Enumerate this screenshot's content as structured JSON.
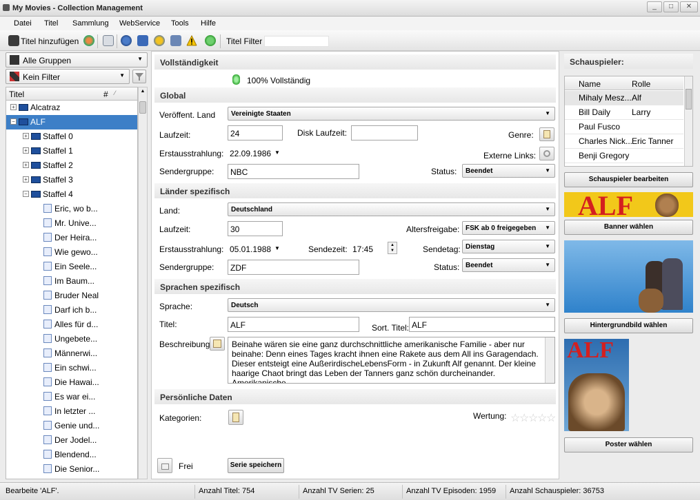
{
  "window": {
    "title": "My Movies - Collection Management"
  },
  "menu": [
    "Datei",
    "Titel",
    "Sammlung",
    "WebService",
    "Tools",
    "Hilfe"
  ],
  "toolbar": {
    "add_title": "Titel hinzufügen",
    "filter_label": "Titel Filter",
    "filter_value": ""
  },
  "left": {
    "group_combo": "Alle Gruppen",
    "filter_combo": "Kein Filter",
    "header_title": "Titel",
    "header_num": "#",
    "tree": [
      {
        "label": "Alcatraz",
        "level": 0,
        "expander": "+",
        "icon": "tv"
      },
      {
        "label": "ALF",
        "level": 0,
        "expander": "−",
        "icon": "tv",
        "selected": true
      },
      {
        "label": "Staffel 0",
        "level": 1,
        "expander": "+",
        "icon": "tv"
      },
      {
        "label": "Staffel 1",
        "level": 1,
        "expander": "+",
        "icon": "tv"
      },
      {
        "label": "Staffel 2",
        "level": 1,
        "expander": "+",
        "icon": "tv"
      },
      {
        "label": "Staffel 3",
        "level": 1,
        "expander": "+",
        "icon": "tv"
      },
      {
        "label": "Staffel 4",
        "level": 1,
        "expander": "−",
        "icon": "tv"
      },
      {
        "label": "Eric, wo b...",
        "level": 2,
        "icon": "ep"
      },
      {
        "label": "Mr. Unive...",
        "level": 2,
        "icon": "ep"
      },
      {
        "label": "Der Heira...",
        "level": 2,
        "icon": "ep"
      },
      {
        "label": "Wie gewo...",
        "level": 2,
        "icon": "ep"
      },
      {
        "label": "Ein Seele...",
        "level": 2,
        "icon": "ep"
      },
      {
        "label": "Im Baum...",
        "level": 2,
        "icon": "ep"
      },
      {
        "label": "Bruder Neal",
        "level": 2,
        "icon": "ep"
      },
      {
        "label": "Darf ich b...",
        "level": 2,
        "icon": "ep"
      },
      {
        "label": "Alles für d...",
        "level": 2,
        "icon": "ep"
      },
      {
        "label": "Ungebete...",
        "level": 2,
        "icon": "ep"
      },
      {
        "label": "Männerwi...",
        "level": 2,
        "icon": "ep"
      },
      {
        "label": "Ein schwi...",
        "level": 2,
        "icon": "ep"
      },
      {
        "label": "Die Hawai...",
        "level": 2,
        "icon": "ep"
      },
      {
        "label": "Es war ei...",
        "level": 2,
        "icon": "ep"
      },
      {
        "label": "In letzter ...",
        "level": 2,
        "icon": "ep"
      },
      {
        "label": "Genie und...",
        "level": 2,
        "icon": "ep"
      },
      {
        "label": "Der Jodel...",
        "level": 2,
        "icon": "ep"
      },
      {
        "label": "Blendend...",
        "level": 2,
        "icon": "ep"
      },
      {
        "label": "Die Senior...",
        "level": 2,
        "icon": "ep"
      }
    ]
  },
  "main": {
    "completeness": {
      "header": "Vollständigkeit",
      "value": "100% Vollständig"
    },
    "global": {
      "header": "Global",
      "release_country_label": "Veröffent. Land",
      "release_country": "Vereinigte Staaten",
      "runtime_label": "Laufzeit:",
      "runtime": "24",
      "disc_runtime_label": "Disk Laufzeit:",
      "disc_runtime": "",
      "genre_label": "Genre:",
      "first_air_label": "Erstausstrahlung:",
      "first_air": "22.09.1986",
      "external_links_label": "Externe Links:",
      "network_label": "Sendergruppe:",
      "network": "NBC",
      "status_label": "Status:",
      "status": "Beendet"
    },
    "country": {
      "header": "Länder spezifisch",
      "country_label": "Land:",
      "country": "Deutschland",
      "runtime_label": "Laufzeit:",
      "runtime": "30",
      "rating_label": "Altersfreigabe:",
      "rating": "FSK ab 0 freigegeben",
      "first_air_label": "Erstausstrahlung:",
      "first_air": "05.01.1988",
      "airtime_label": "Sendezeit:",
      "airtime": "17:45",
      "airday_label": "Sendetag:",
      "airday": "Dienstag",
      "network_label": "Sendergruppe:",
      "network": "ZDF",
      "status_label": "Status:",
      "status": "Beendet"
    },
    "language": {
      "header": "Sprachen spezifisch",
      "language_label": "Sprache:",
      "language": "Deutsch",
      "title_label": "Titel:",
      "title": "ALF",
      "sort_title_label": "Sort. Titel:",
      "sort_title": "ALF",
      "description_label": "Beschreibung:",
      "description": "Beinahe wären sie eine ganz durchschnittliche amerikanische Familie - aber nur beinahe: Denn eines Tages kracht ihnen eine Rakete aus dem All ins Garagendach. Dieser entsteigt eine AußerirdischeLebensForm - in Zukunft Alf genannt. Der kleine haarige Chaot bringt das Leben der Tanners ganz schön durcheinander. Amerikanische"
    },
    "personal": {
      "header": "Persönliche Daten",
      "categories_label": "Kategorien:",
      "rating_label": "Wertung:",
      "rating_stars": 0
    },
    "footer": {
      "lock_label": "Frei",
      "save_button": "Serie speichern"
    }
  },
  "right": {
    "actors_header": "Schauspieler:",
    "col_name": "Name",
    "col_role": "Rolle",
    "actors": [
      {
        "name": "Mihaly Mesz...",
        "role": "Alf",
        "selected": true
      },
      {
        "name": "Bill Daily",
        "role": "Larry"
      },
      {
        "name": "Paul Fusco",
        "role": ""
      },
      {
        "name": "Charles Nick...",
        "role": "Eric Tanner"
      },
      {
        "name": "Benji Gregory",
        "role": ""
      }
    ],
    "edit_actors_button": "Schauspieler bearbeiten",
    "banner_text": "ALF",
    "banner_button": "Banner wählen",
    "background_button": "Hintergrundbild wählen",
    "poster_text": "ALF",
    "poster_button": "Poster wählen"
  },
  "statusbar": {
    "editing": "Bearbeite 'ALF'.",
    "titles": "Anzahl Titel: 754",
    "series": "Anzahl TV Serien: 25",
    "episodes": "Anzahl TV Episoden: 1959",
    "actors": "Anzahl Schauspieler: 36753"
  },
  "colors": {
    "selection": "#3d7fc7",
    "banner_red": "#d41f1f",
    "banner_yellow": "#f2c81a"
  }
}
